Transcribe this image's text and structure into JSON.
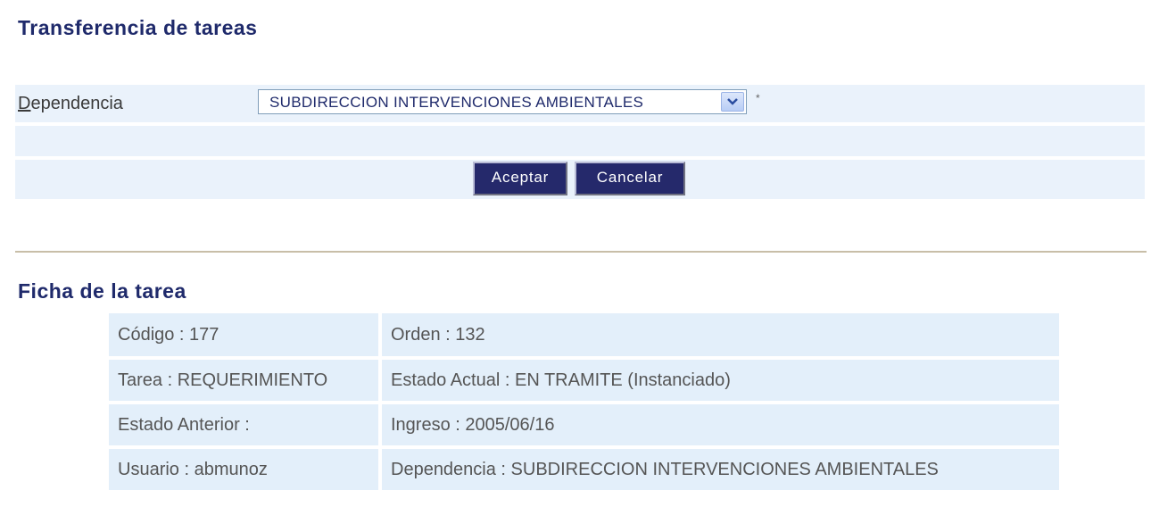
{
  "title": "Transferencia de tareas",
  "form": {
    "dependencia_label_first": "D",
    "dependencia_label_rest": "ependencia",
    "dependencia_value": "SUBDIRECCION INTERVENCIONES AMBIENTALES",
    "required_mark": "*",
    "accept_label": "Aceptar",
    "cancel_label": "Cancelar"
  },
  "ficha": {
    "title": "Ficha de la tarea",
    "rows": [
      {
        "left": "Código : 177",
        "right": "Orden : 132"
      },
      {
        "left": "Tarea : REQUERIMIENTO",
        "right": "Estado Actual : EN TRAMITE (Instanciado)"
      },
      {
        "left": "Estado Anterior :",
        "right": "Ingreso : 2005/06/16"
      },
      {
        "left": "Usuario : abmunoz",
        "right": "Dependencia : SUBDIRECCION INTERVENCIONES AMBIENTALES"
      }
    ]
  },
  "colors": {
    "title": "#1f2a6b",
    "row_bg": "#eaf2fb",
    "button_bg": "#25296b"
  }
}
